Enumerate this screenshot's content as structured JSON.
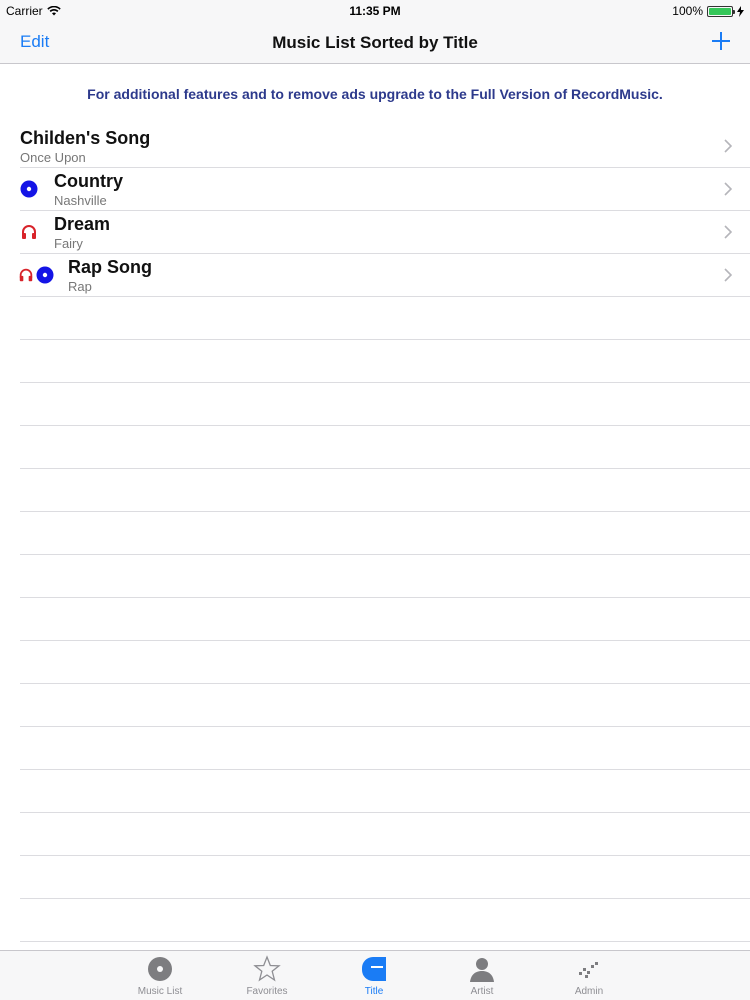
{
  "status": {
    "carrier": "Carrier",
    "time": "11:35 PM",
    "battery": "100%"
  },
  "nav": {
    "edit_label": "Edit",
    "title": "Music List Sorted by Title"
  },
  "banner": "For additional features and to remove ads upgrade to the Full Version of RecordMusic.",
  "songs": [
    {
      "title": "Childen's Song",
      "subtitle": "Once Upon",
      "icons": []
    },
    {
      "title": "Country",
      "subtitle": "Nashville",
      "icons": [
        "vinyl-icon"
      ]
    },
    {
      "title": "Dream",
      "subtitle": "Fairy",
      "icons": [
        "headphones-icon"
      ]
    },
    {
      "title": "Rap Song",
      "subtitle": "Rap",
      "icons": [
        "headphones-icon",
        "vinyl-icon"
      ]
    }
  ],
  "tabs": [
    {
      "label": "Music List",
      "icon": "disc-icon",
      "active": false
    },
    {
      "label": "Favorites",
      "icon": "star-icon",
      "active": false
    },
    {
      "label": "Title",
      "icon": "title-icon",
      "active": true
    },
    {
      "label": "Artist",
      "icon": "person-icon",
      "active": false
    },
    {
      "label": "Admin",
      "icon": "admin-icon",
      "active": false
    }
  ],
  "colors": {
    "accent": "#1a7cf5",
    "banner": "#2d3a8c",
    "vinyl": "#1414e6",
    "headphones": "#d8232a"
  }
}
